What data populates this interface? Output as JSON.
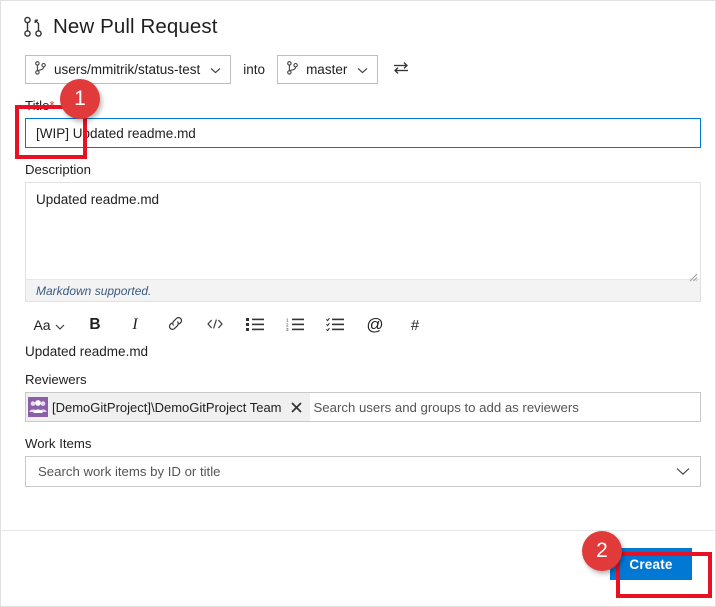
{
  "header": {
    "title": "New Pull Request",
    "icon": "pull-request-icon"
  },
  "branches": {
    "source": "users/mmitrik/status-test",
    "into_label": "into",
    "target": "master",
    "swap_icon": "swap-arrows-icon",
    "branch_icon": "branch-icon",
    "chevron_icon": "chevron-down-icon"
  },
  "title_field": {
    "label": "Title",
    "required_marker": "*",
    "value": "[WIP] Updated readme.md"
  },
  "description_field": {
    "label": "Description",
    "value": "Updated readme.md",
    "markdown_note": "Markdown supported.",
    "resize_icon": "resize-grip-icon"
  },
  "format_toolbar": {
    "buttons": [
      {
        "name": "font-size-button",
        "label": "Aa",
        "icon": "chevron-down-icon"
      },
      {
        "name": "bold-button",
        "label": "B",
        "icon": "bold-icon"
      },
      {
        "name": "italic-button",
        "label": "I",
        "icon": "italic-icon"
      },
      {
        "name": "link-button",
        "label": "",
        "icon": "link-icon"
      },
      {
        "name": "code-button",
        "label": "",
        "icon": "code-icon"
      },
      {
        "name": "bulleted-list-button",
        "label": "",
        "icon": "bulleted-list-icon"
      },
      {
        "name": "numbered-list-button",
        "label": "",
        "icon": "numbered-list-icon"
      },
      {
        "name": "task-list-button",
        "label": "",
        "icon": "task-list-icon"
      },
      {
        "name": "mention-button",
        "label": "@",
        "icon": "at-mention-icon"
      },
      {
        "name": "work-item-link-button",
        "label": "#",
        "icon": "hash-icon"
      }
    ]
  },
  "preview": {
    "text": "Updated readme.md"
  },
  "reviewers_field": {
    "label": "Reviewers",
    "chip": {
      "label": "[DemoGitProject]\\DemoGitProject Team",
      "avatar_icon": "group-avatar-icon",
      "remove_icon": "close-icon"
    },
    "placeholder": "Search users and groups to add as reviewers"
  },
  "work_items_field": {
    "label": "Work Items",
    "placeholder": "Search work items by ID or title",
    "chevron_icon": "chevron-down-icon"
  },
  "footer": {
    "create_label": "Create"
  },
  "annotations": {
    "badge_one": "1",
    "badge_two": "2",
    "color": "#e03a3a",
    "rect_color": "#e81123"
  }
}
